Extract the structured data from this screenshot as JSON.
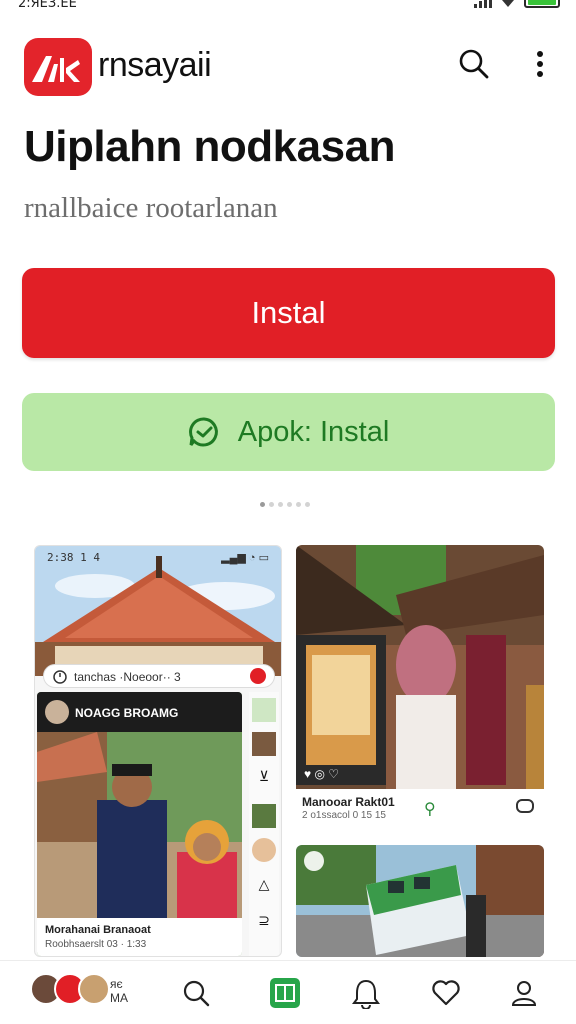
{
  "status_bar": {
    "time": "2:ЯЕЗ.ЕЕ"
  },
  "header": {
    "app_name": "rnsayaii"
  },
  "main": {
    "title": "Uiplahn nodkasan",
    "subtitle": "rnallbaice rootarlanan",
    "install_label": "Instal",
    "apk_install_label": "Apok: Instal"
  },
  "screenshots": {
    "shot1": {
      "time": "2:38 1 4",
      "pill_text": "tanchas ·Noeoor·· 3",
      "feed_head": "NOAGG BROAMG",
      "caption_title": "Morahanai Branaoat",
      "caption_sub": "Roobhsaerslt 03 · 1:33"
    },
    "shot2": {
      "caption_title": "Manooar Rakt01",
      "caption_sub": "2 o1ssacol 0 15 15"
    }
  },
  "bottom_nav": {
    "label_line1": "яє",
    "label_line2": "MA"
  },
  "colors": {
    "brand_red": "#e11f26",
    "apk_green_bg": "#b9e8a6",
    "apk_green_text": "#1e7a23",
    "nav_green": "#27a54a"
  }
}
